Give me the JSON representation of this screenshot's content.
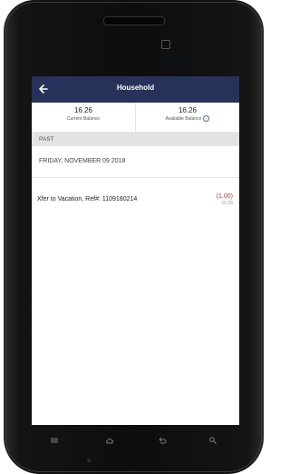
{
  "app": {
    "title": "Household"
  },
  "balances": {
    "current": {
      "value": "16.26",
      "label": "Current Balance"
    },
    "available": {
      "value": "16.26",
      "label": "Available Balance"
    }
  },
  "section": {
    "label": "PAST"
  },
  "date_header": "FRIDAY, NOVEMBER 09 2018",
  "transactions": [
    {
      "description": "Xfer to Vacation, Ref#: 1109180214",
      "amount": "(1.00)",
      "running_balance": "16.26"
    }
  ],
  "icons": {
    "back": "arrow-left-icon",
    "info": "info-icon",
    "menu": "menu-key-icon",
    "home": "home-key-icon",
    "back_key": "back-key-icon",
    "search": "search-key-icon"
  },
  "colors": {
    "header": "#27325a",
    "negative_amount": "#a33a3a",
    "section_bg": "#e3e3e3"
  }
}
